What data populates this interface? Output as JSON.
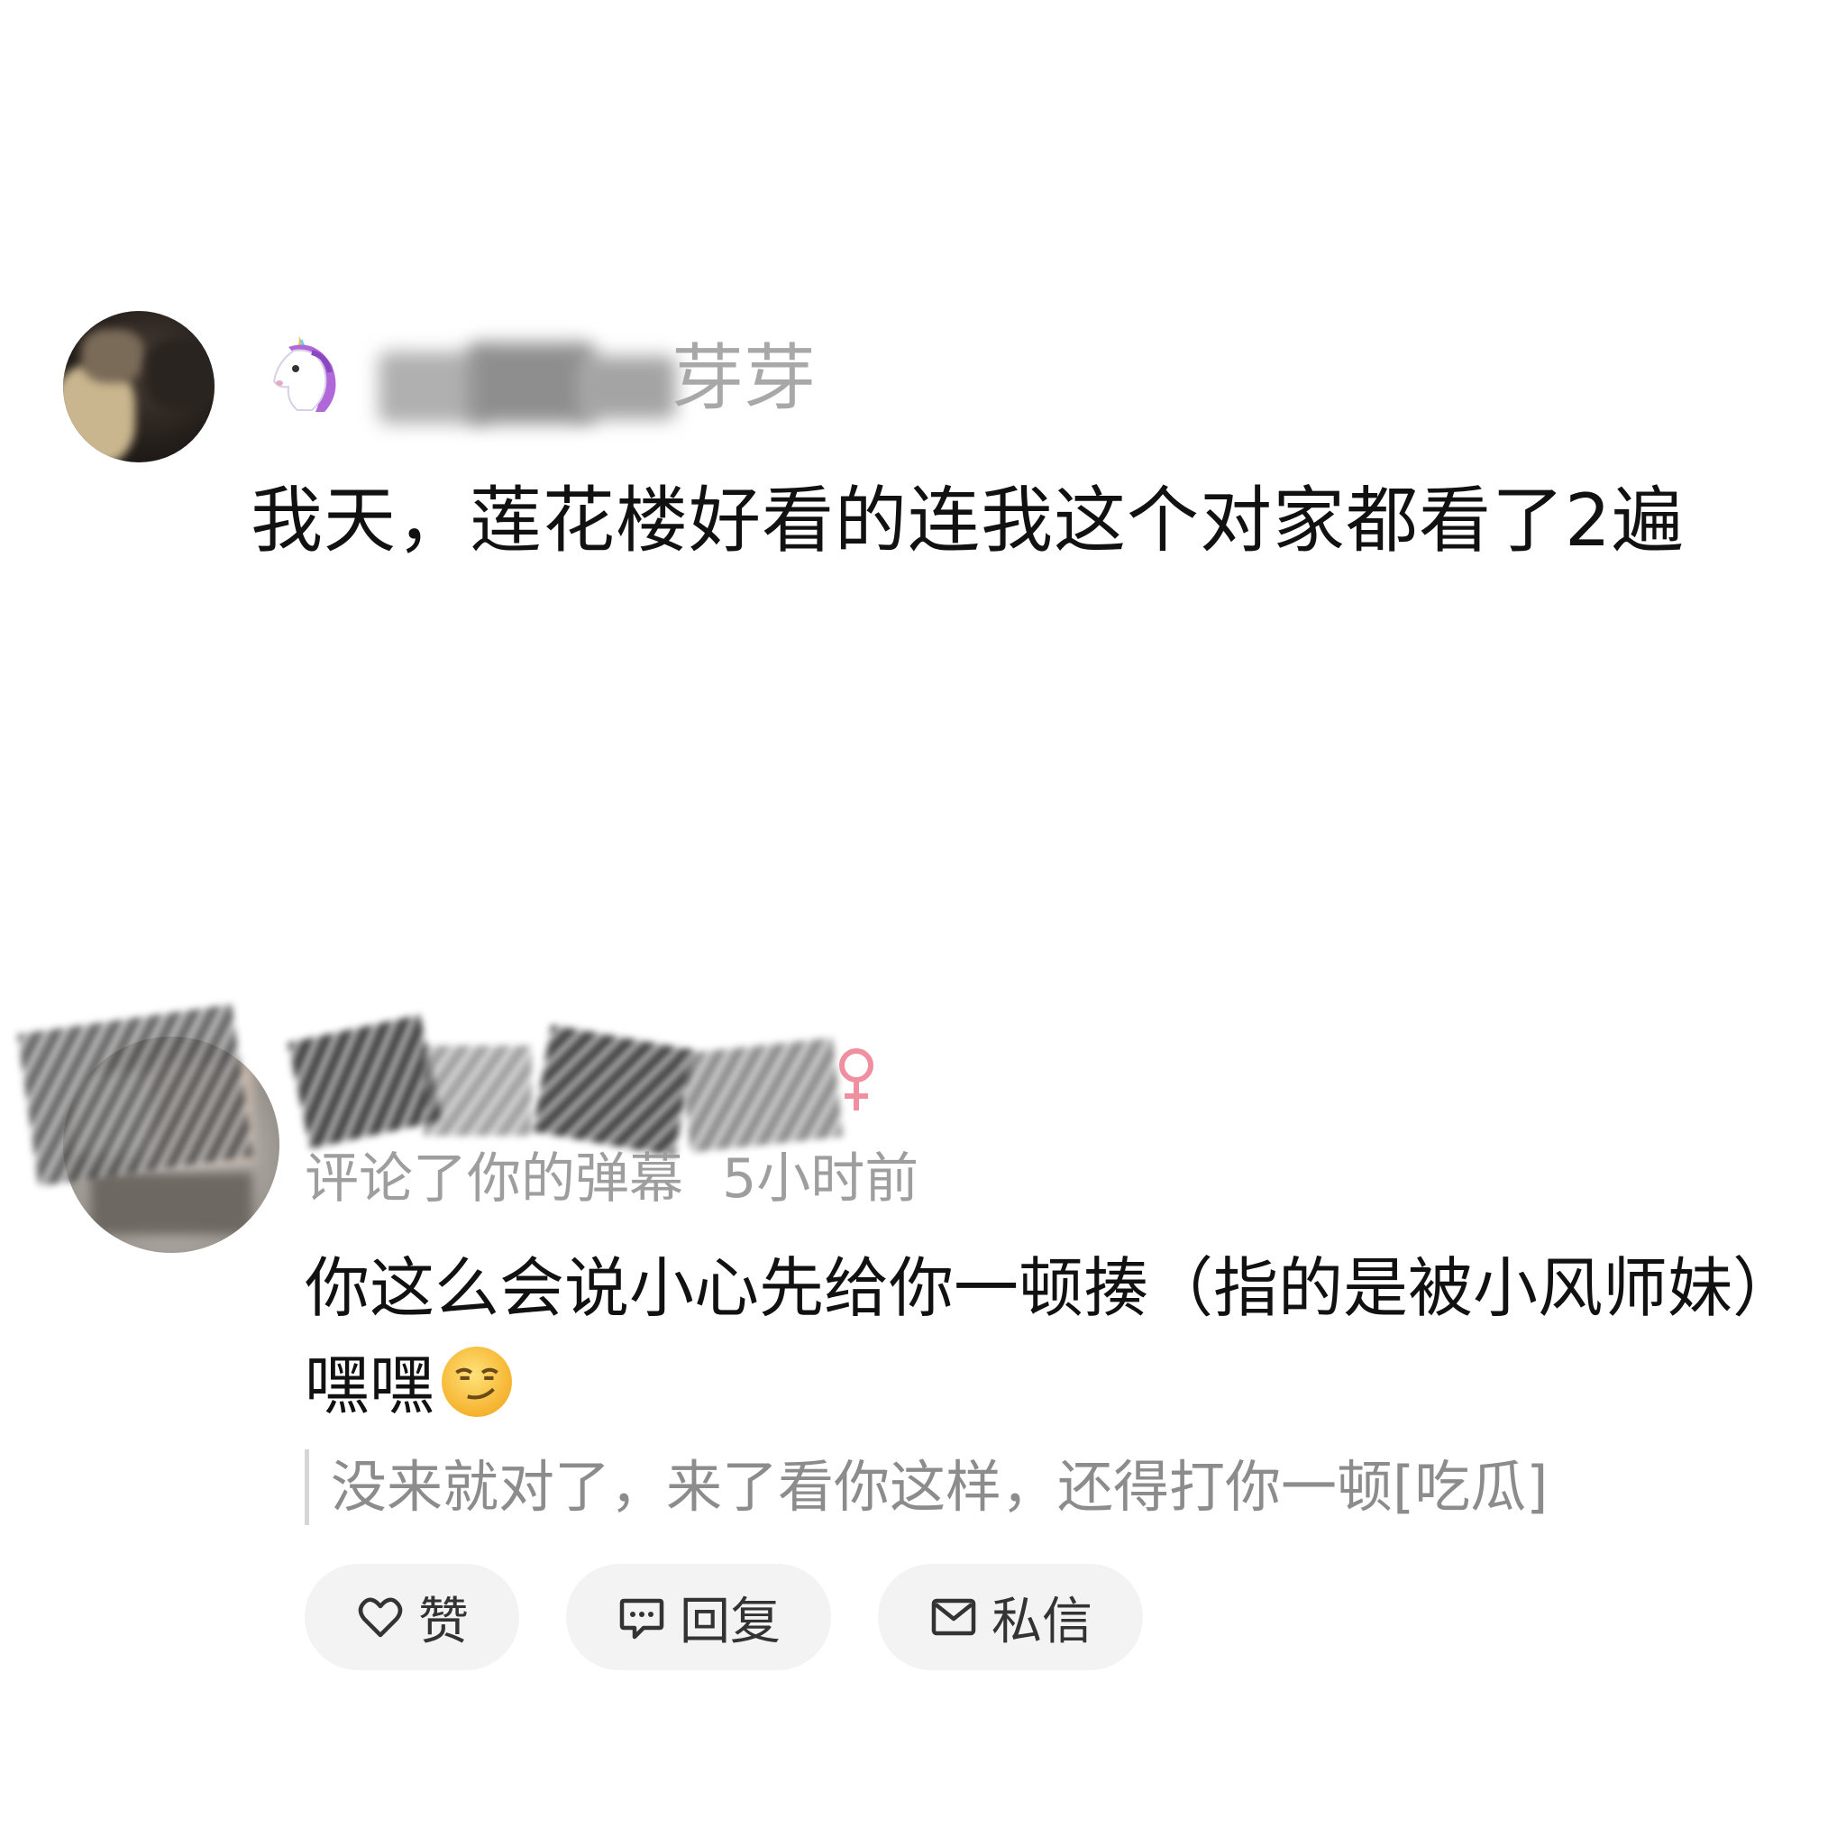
{
  "comment1": {
    "username_visible": "芽芽",
    "text": "我天，莲花楼好看的连我这个对家都看了2遍"
  },
  "comment2": {
    "notification": "评论了你的弹幕",
    "time": "5小时前",
    "text": "你这么会说小心先给你一顿揍（指的是被小风师妹）嘿嘿",
    "quoted_text": "没来就对了，来了看你这样，还得打你一顿[吃瓜]"
  },
  "actions": {
    "like_label": "赞",
    "reply_label": "回复",
    "message_label": "私信"
  },
  "icons": {
    "username_badge": "unicorn-emoji",
    "gender": "female-icon",
    "reaction": "smirking-face-emoji",
    "like": "heart-icon",
    "reply": "chat-bubble-icon",
    "message": "envelope-icon"
  },
  "colors": {
    "text_primary": "#111111",
    "text_secondary": "#9e9e9e",
    "quote_text": "#8c8c8c",
    "button_bg": "#f3f3f3",
    "gender_pink": "#f08fa0"
  }
}
